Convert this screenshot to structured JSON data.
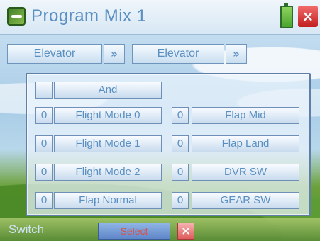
{
  "window": {
    "title": "Program Mix 1"
  },
  "header": {
    "source_channel": "Elevator",
    "source_arrow": "»",
    "dest_channel": "Elevator",
    "dest_arrow": "»"
  },
  "panel": {
    "and_label": "And",
    "and_value": "",
    "left_items": [
      {
        "num": "0",
        "label": "Flight Mode 0"
      },
      {
        "num": "0",
        "label": "Flight Mode 1"
      },
      {
        "num": "0",
        "label": "Flight Mode 2"
      },
      {
        "num": "0",
        "label": "Flap Normal"
      }
    ],
    "right_items": [
      {
        "num": "0",
        "label": "Flap Mid"
      },
      {
        "num": "0",
        "label": "Flap Land"
      },
      {
        "num": "0",
        "label": "DVR SW"
      },
      {
        "num": "0",
        "label": "GEAR SW"
      }
    ]
  },
  "footer": {
    "switch_label": "Switch",
    "select_label": "Select",
    "close_label": "×"
  }
}
